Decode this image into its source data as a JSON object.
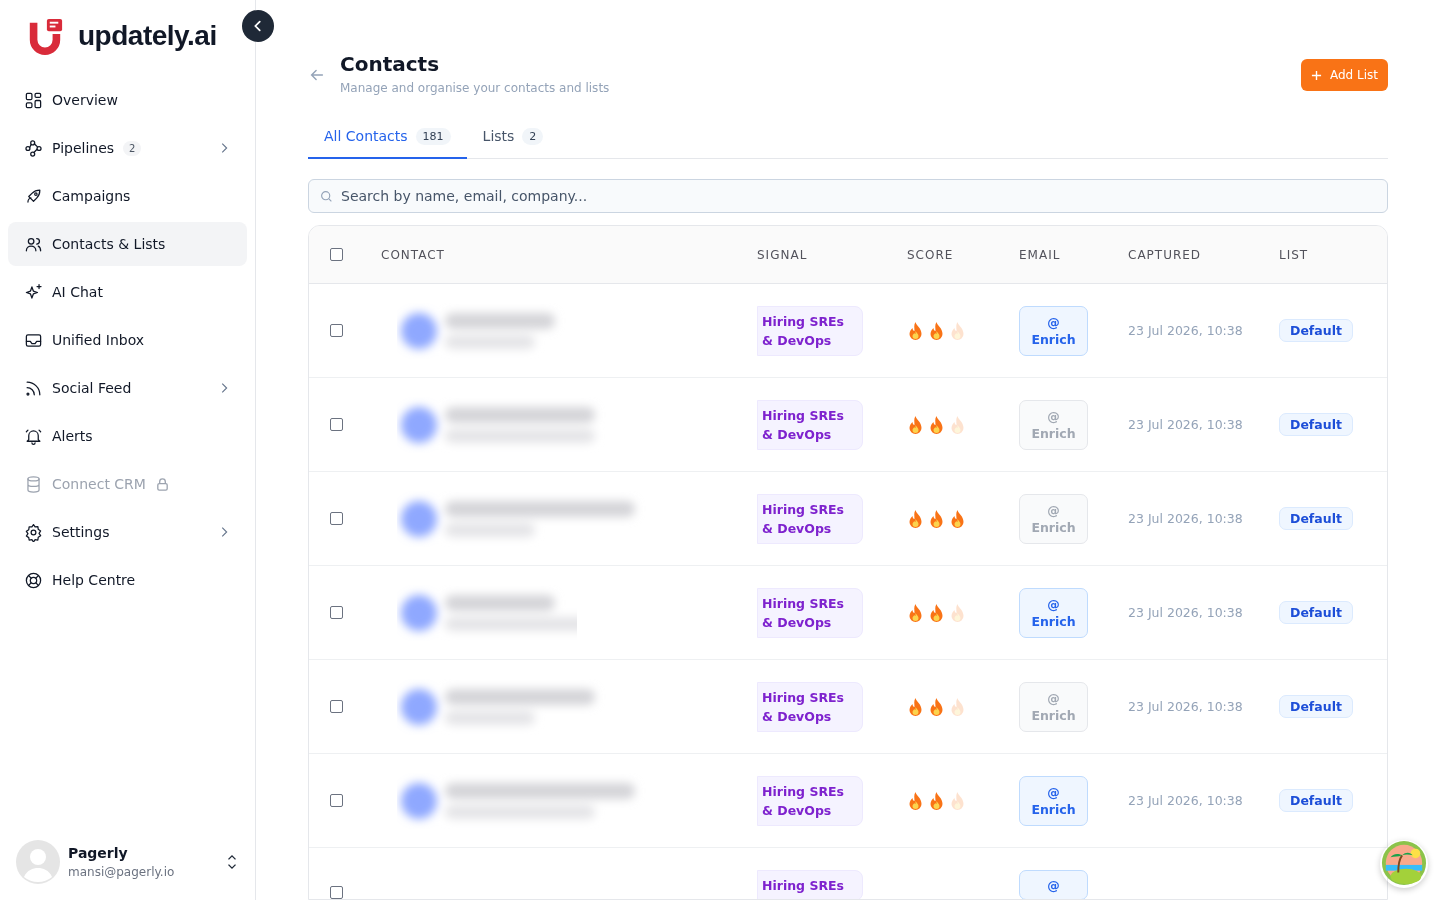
{
  "brand": {
    "name": "updately.ai"
  },
  "sidebar": {
    "items": [
      {
        "label": "Overview",
        "selected": false,
        "disabled": false,
        "has_submenu": false
      },
      {
        "label": "Pipelines",
        "selected": false,
        "disabled": false,
        "has_submenu": true,
        "badge": "2"
      },
      {
        "label": "Campaigns",
        "selected": false,
        "disabled": false,
        "has_submenu": false
      },
      {
        "label": "Contacts & Lists",
        "selected": true,
        "disabled": false,
        "has_submenu": false
      },
      {
        "label": "AI Chat",
        "selected": false,
        "disabled": false,
        "has_submenu": false
      },
      {
        "label": "Unified Inbox",
        "selected": false,
        "disabled": false,
        "has_submenu": false
      },
      {
        "label": "Social Feed",
        "selected": false,
        "disabled": false,
        "has_submenu": true
      },
      {
        "label": "Alerts",
        "selected": false,
        "disabled": false,
        "has_submenu": false
      },
      {
        "label": "Connect CRM",
        "selected": false,
        "disabled": true,
        "has_submenu": false
      },
      {
        "label": "Settings",
        "selected": false,
        "disabled": false,
        "has_submenu": true
      },
      {
        "label": "Help Centre",
        "selected": false,
        "disabled": false,
        "has_submenu": false
      }
    ],
    "user": {
      "name": "Pagerly",
      "email": "mansi@pagerly.io"
    }
  },
  "header": {
    "title": "Contacts",
    "subtitle": "Manage and organise your contacts and lists",
    "add_button": "Add List"
  },
  "tabs": [
    {
      "label": "All Contacts",
      "count": "181",
      "selected": true
    },
    {
      "label": "Lists",
      "count": "2",
      "selected": false
    }
  ],
  "search": {
    "placeholder": "Search by name, email, company..."
  },
  "table": {
    "select_all_checked": false,
    "columns": [
      "CONTACT",
      "SIGNAL",
      "SCORE",
      "EMAIL",
      "CAPTURED",
      "LIST"
    ],
    "rows": [
      {
        "kind": "full",
        "checked": false,
        "signal": "Hiring SREs & DevOps",
        "stars": 2,
        "email_icon": "@",
        "email_label": "Enrich",
        "enrich_enabled": true,
        "captured": "23 Jul 2026, 10:38",
        "list": "Default"
      },
      {
        "kind": "full",
        "checked": false,
        "signal": "Hiring SREs & DevOps",
        "stars": 2,
        "email_icon": "@",
        "email_label": "Enrich",
        "enrich_enabled": false,
        "captured": "23 Jul 2026, 10:38",
        "list": "Default"
      },
      {
        "kind": "full",
        "checked": false,
        "signal": "Hiring SREs & DevOps",
        "stars": 3,
        "email_icon": "@",
        "email_label": "Enrich",
        "enrich_enabled": false,
        "captured": "23 Jul 2026, 10:38",
        "list": "Default"
      },
      {
        "kind": "full",
        "checked": false,
        "signal": "Hiring SREs & DevOps",
        "stars": 2,
        "email_icon": "@",
        "email_label": "Enrich",
        "enrich_enabled": true,
        "captured": "23 Jul 2026, 10:38",
        "list": "Default"
      },
      {
        "kind": "full",
        "checked": false,
        "signal": "Hiring SREs & DevOps",
        "stars": 2,
        "email_icon": "@",
        "email_label": "Enrich",
        "enrich_enabled": false,
        "captured": "23 Jul 2026, 10:38",
        "list": "Default"
      },
      {
        "kind": "full",
        "checked": false,
        "signal": "Hiring SREs & DevOps",
        "stars": 2,
        "email_icon": "@",
        "email_label": "Enrich",
        "enrich_enabled": true,
        "captured": "23 Jul 2026, 10:38",
        "list": "Default"
      },
      {
        "kind": "partial",
        "checked": false,
        "signal": "Hiring SREs",
        "email_icon": "@"
      }
    ]
  }
}
